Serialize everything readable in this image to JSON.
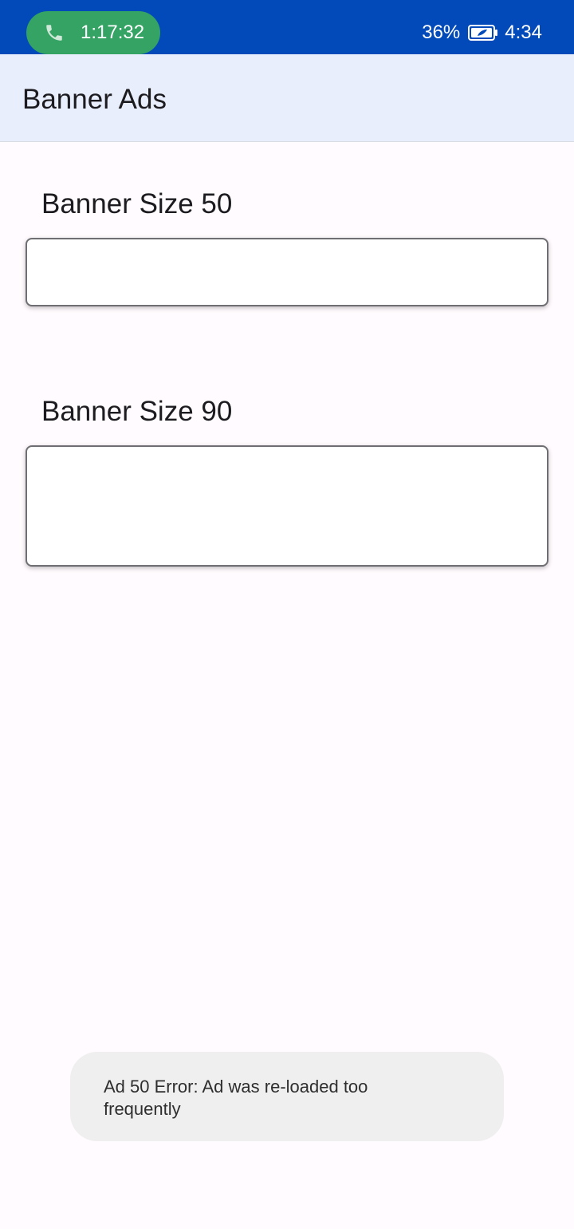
{
  "status_bar": {
    "call_timer": "1:17:32",
    "battery_percent": "36%",
    "clock": "4:34",
    "colors": {
      "bar": "#0249b9",
      "call_pill": "#34a364"
    },
    "icons": [
      "phone-icon",
      "battery-icon"
    ]
  },
  "app_bar": {
    "title": "Banner Ads"
  },
  "sections": {
    "banner50": {
      "label": "Banner Size 50"
    },
    "banner90": {
      "label": "Banner Size 90"
    }
  },
  "toast": {
    "message": "Ad 50 Error: Ad was re-loaded too frequently"
  }
}
